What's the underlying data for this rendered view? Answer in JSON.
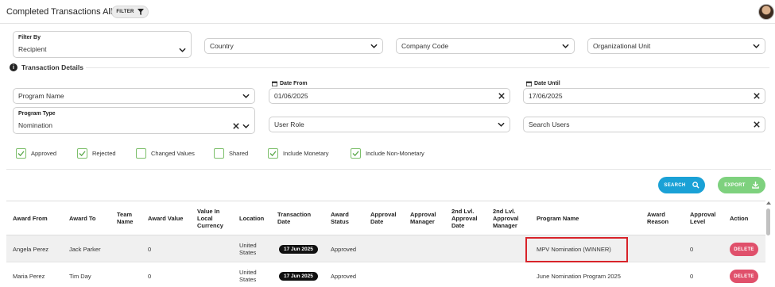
{
  "header": {
    "title": "Completed Transactions All",
    "filter_label": "FILTER"
  },
  "filters": {
    "filter_by_label": "Filter By",
    "filter_by_value": "Recipient",
    "country_placeholder": "Country",
    "company_code_placeholder": "Company Code",
    "org_unit_placeholder": "Organizational Unit"
  },
  "transaction_details": {
    "title": "Transaction Details",
    "program_name_placeholder": "Program Name",
    "date_from_label": "Date From",
    "date_from_value": "01/06/2025",
    "date_until_label": "Date Until",
    "date_until_value": "17/06/2025",
    "program_type_label": "Program Type",
    "program_type_value": "Nomination",
    "user_role_placeholder": "User Role",
    "search_users_placeholder": "Search Users"
  },
  "checkboxes": [
    {
      "label": "Approved",
      "checked": true
    },
    {
      "label": "Rejected",
      "checked": true
    },
    {
      "label": "Changed Values",
      "checked": false
    },
    {
      "label": "Shared",
      "checked": false
    },
    {
      "label": "Include Monetary",
      "checked": true
    },
    {
      "label": "Include Non-Monetary",
      "checked": true
    }
  ],
  "actions": {
    "search_label": "SEARCH",
    "export_label": "EXPORT"
  },
  "table": {
    "columns": {
      "award_from": "Award From",
      "award_to": "Award To",
      "team_name": "Team Name",
      "award_value": "Award Value",
      "value_local": "Value In Local Currency",
      "location": "Location",
      "transaction_date": "Transaction Date",
      "award_status": "Award Status",
      "approval_date": "Approval Date",
      "approval_manager": "Approval Manager",
      "lvl2_date": "2nd Lvl. Approval Date",
      "lvl2_manager": "2nd Lvl. Approval Manager",
      "program_name": "Program Name",
      "award_reason": "Award Reason",
      "approval_level": "Approval Level",
      "action": "Action"
    },
    "rows": [
      {
        "award_from": "Angela Perez",
        "award_to": "Jack Parker",
        "award_value": "0",
        "location": "United States",
        "transaction_date": "17 Jun 2025",
        "award_status": "Approved",
        "program_name": "MPV Nomination (WINNER)",
        "approval_level": "0",
        "action": "DELETE"
      },
      {
        "award_from": "Maria Perez",
        "award_to": "Tim Day",
        "award_value": "0",
        "location": "United States",
        "transaction_date": "17 Jun 2025",
        "award_status": "Approved",
        "program_name": "June Nomination Program 2025",
        "approval_level": "0",
        "action": "DELETE"
      }
    ]
  },
  "colors": {
    "search_button": "#1aa1d6",
    "export_button": "#7ed17e",
    "delete_button": "#e0506b",
    "checkbox_border": "#7cbf6a",
    "highlight_border": "#d8232a"
  }
}
